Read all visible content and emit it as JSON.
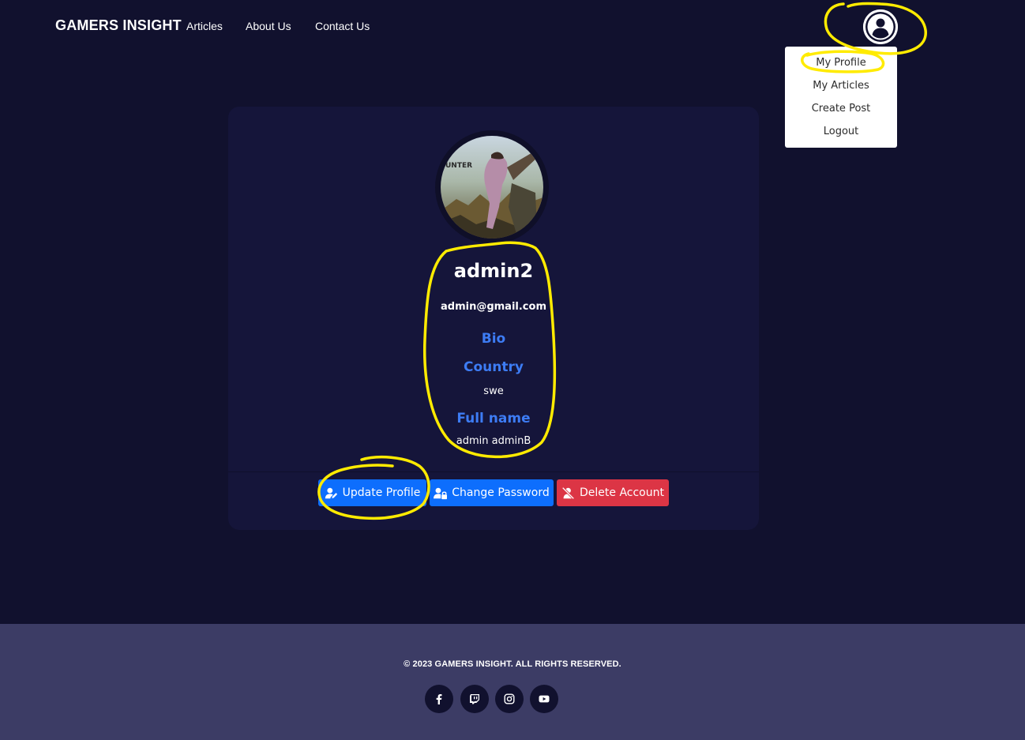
{
  "nav": {
    "brand": "GAMERS INSIGHT",
    "links": [
      "Articles",
      "About Us",
      "Contact Us"
    ]
  },
  "user_menu": {
    "items": [
      "My Profile",
      "My Articles",
      "Create Post",
      "Logout"
    ]
  },
  "profile": {
    "username": "admin2",
    "email": "admin@gmail.com",
    "bio_label": "Bio",
    "country_label": "Country",
    "country_value": "swe",
    "fullname_label": "Full name",
    "fullname_value": "admin adminB"
  },
  "actions": {
    "update": "Update Profile",
    "change_password": "Change Password",
    "delete": "Delete Account"
  },
  "footer": {
    "copyright": "© 2023 GAMERS INSIGHT. ALL RIGHTS RESERVED.",
    "social_icons": [
      "facebook-icon",
      "twitch-icon",
      "instagram-icon",
      "youtube-icon"
    ]
  },
  "colors": {
    "page_bg": "#11112e",
    "card_bg": "#15153a",
    "footer_bg": "#3c3c65",
    "accent_blue": "#3d7cf4",
    "primary_button": "#0d6efd",
    "danger_button": "#dc3545",
    "annotation": "#ffeb00"
  }
}
